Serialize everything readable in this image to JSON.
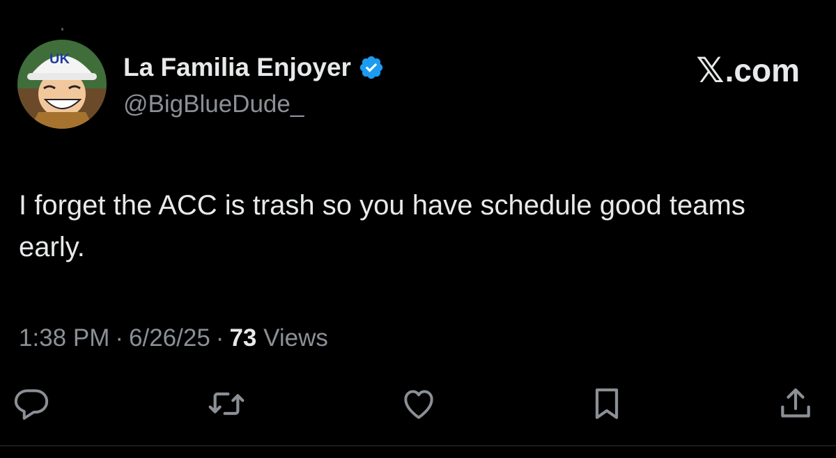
{
  "brand": {
    "glyph": "𝕏",
    "suffix": ".com"
  },
  "author": {
    "display_name": "La Familia Enjoyer",
    "handle": "@BigBlueDude_",
    "verified": true,
    "avatar_icon": "avatar-cartoon-character-icon"
  },
  "tweet": {
    "text": "I forget the ACC is trash so you have schedule good teams early.",
    "time": "1:38 PM",
    "date": "6/26/25",
    "separator": "·",
    "views_count": "73",
    "views_label": "Views"
  },
  "actions": [
    {
      "name": "reply",
      "icon": "reply-icon"
    },
    {
      "name": "repost",
      "icon": "repost-icon"
    },
    {
      "name": "like",
      "icon": "heart-icon"
    },
    {
      "name": "bookmark",
      "icon": "bookmark-icon"
    },
    {
      "name": "share",
      "icon": "share-icon"
    }
  ],
  "colors": {
    "background": "#000000",
    "primary_text": "#e7e9ea",
    "secondary_text": "#8b9096",
    "verified_blue": "#1d9bf0",
    "divider": "#2f3336"
  }
}
